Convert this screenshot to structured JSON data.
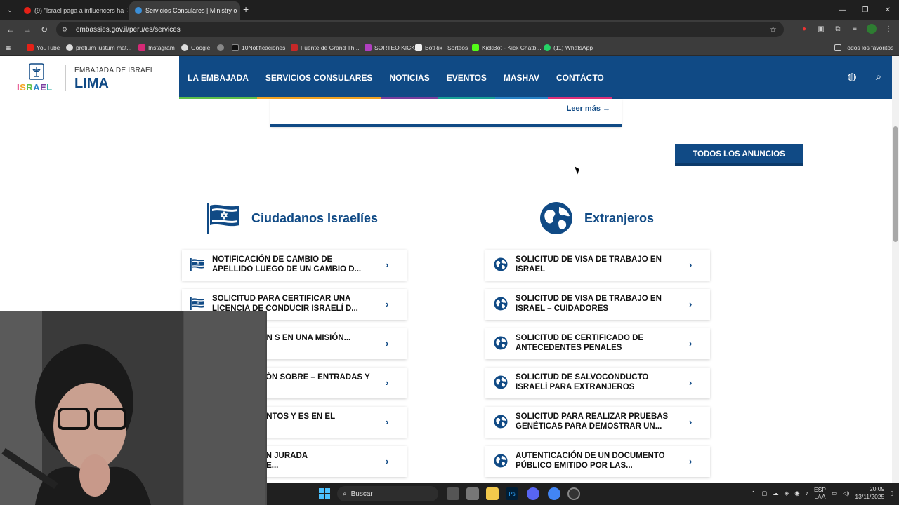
{
  "browser": {
    "tabs": [
      {
        "title": "(9) \"Israel paga a influencers ha",
        "active": false
      },
      {
        "title": "Servicios Consulares | Ministry o",
        "active": true
      }
    ],
    "url": "embassies.gov.il/peru/es/services",
    "bookmarks": [
      "YouTube",
      "pretium iustum mat...",
      "Instagram",
      "Google",
      "",
      "10Notificaciones",
      "Fuente de Grand Th...",
      "SORTEO KICK",
      "BotRix | Sorteos",
      "KickBot - Kick Chatb...",
      "(11) WhatsApp"
    ],
    "all_bookmarks": "Todos los favoritos"
  },
  "site": {
    "logo_word": "ISRAEL",
    "embassy_sub": "EMBAJADA DE ISRAEL",
    "embassy_city": "LIMA",
    "nav": [
      {
        "label": "LA EMBAJADA",
        "color": "#5fbf4a"
      },
      {
        "label": "SERVICIOS CONSULARES",
        "color": "#f5a623"
      },
      {
        "label": "NOTICIAS",
        "color": "#7b3fa0"
      },
      {
        "label": "EVENTOS",
        "color": "#1aa39a"
      },
      {
        "label": "MASHAV",
        "color": "#2a86c9"
      },
      {
        "label": "CONTÁCTO",
        "color": "#e2317a"
      }
    ]
  },
  "content": {
    "read_more": "Leer más →",
    "all_announcements": "TODOS LOS ANUNCIOS",
    "israeli_heading": "Ciudadanos Israelíes",
    "foreign_heading": "Extranjeros",
    "israeli_services": [
      "NOTIFICACIÓN DE CAMBIO DE APELLIDO LUEGO DE UN CAMBIO D...",
      "SOLICITUD PARA CERTIFICAR UNA LICENCIA DE CONDUCIR ISRAELÍ D...",
      "N DE FIRMA EN S EN UNA MISIÓN...",
      "E INFORMACIÓN SOBRE – ENTRADAS Y SALIDA...",
      "E COMPLEMENTOS Y ES EN EL REGISTRO...",
      "DECLARACIÓN JURADA PRESENTANTE..."
    ],
    "foreign_services": [
      "SOLICITUD DE VISA DE TRABAJO EN ISRAEL",
      "SOLICITUD DE VISA DE TRABAJO EN ISRAEL – CUIDADORES",
      "SOLICITUD DE CERTIFICADO DE ANTECEDENTES PENALES",
      "SOLICITUD DE SALVOCONDUCTO ISRAELÍ PARA EXTRANJEROS",
      "SOLICITUD PARA REALIZAR PRUEBAS GENÉTICAS PARA DEMOSTRAR UN...",
      "AUTENTICACIÓN DE UN DOCUMENTO PÚBLICO EMITIDO POR LAS..."
    ]
  },
  "taskbar": {
    "search": "Buscar",
    "lang1": "ESP",
    "lang2": "LAA",
    "time": "20:09",
    "date": "13/11/2025"
  }
}
